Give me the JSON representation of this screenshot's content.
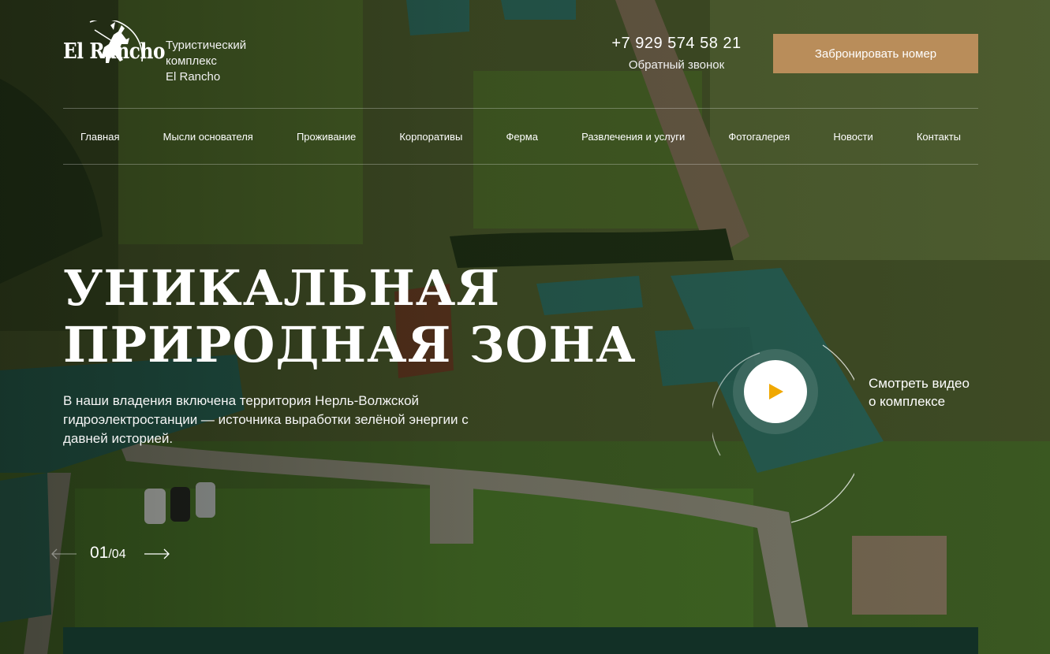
{
  "brand": {
    "logo_text": "El Rancho",
    "tagline": [
      "Туристический",
      "комплекс",
      "El Rancho"
    ]
  },
  "header": {
    "phone": "+7 929 574 58 21",
    "callback": "Обратный звонок",
    "book_button": "Забронировать номер"
  },
  "nav": {
    "items": [
      "Главная",
      "Мысли основателя",
      "Проживание",
      "Корпоративы",
      "Ферма",
      "Развлечения и услуги",
      "Фотогалерея",
      "Новости",
      "Контакты"
    ]
  },
  "hero": {
    "title_line1": "УНИКАЛЬНАЯ",
    "title_line2": "ПРИРОДНАЯ ЗОНА",
    "description": "В наши владения включена территория Нерль-Волжской гидроэлектростанции — источника выработки зелёной энергии с давней историей."
  },
  "video": {
    "label_line1": "Смотреть видео",
    "label_line2": "о комплексе"
  },
  "slider": {
    "current": "01",
    "total": "/04"
  },
  "colors": {
    "accent": "#b98d5a",
    "play_icon": "#f0a800",
    "bottom_panel": "#123026"
  },
  "icons": [
    "horse-rider-icon",
    "play-icon",
    "arrow-left-icon",
    "arrow-right-icon"
  ]
}
